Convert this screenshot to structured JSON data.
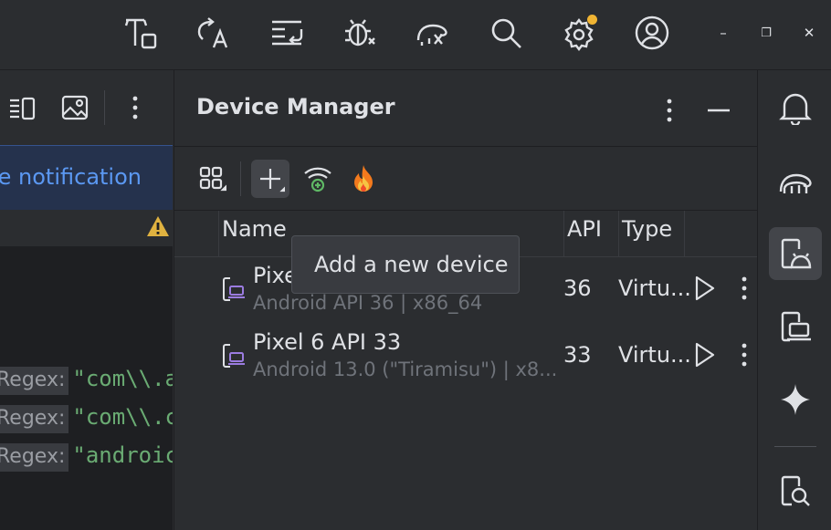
{
  "toolbar": {
    "icons": [
      "project-structure-icon",
      "translate-icon",
      "format-icon",
      "debug-bug-icon",
      "gradle-sync-icon",
      "search-icon",
      "settings-icon",
      "account-icon"
    ],
    "settings_badge_color": "#f0b433"
  },
  "window_controls": {
    "minimize": "–",
    "restore": "❐",
    "close": "✕"
  },
  "editor": {
    "banner_text": "le notification",
    "code_lines": [
      {
        "key": "Regex:",
        "value": "\"com\\\\.a"
      },
      {
        "key": "Regex:",
        "value": "\"com\\\\.c"
      },
      {
        "key": "Regex:",
        "value": "\"androic"
      }
    ]
  },
  "device_manager": {
    "title": "Device Manager",
    "columns": {
      "name": "Name",
      "api": "API",
      "type": "Type"
    },
    "devices": [
      {
        "name": "Pixe",
        "subtitle": "Android API 36 | x86_64",
        "api": "36",
        "type": "Virtu..."
      },
      {
        "name": "Pixel 6 API 33",
        "subtitle": "Android 13.0 (\"Tiramisu\") | x8...",
        "api": "33",
        "type": "Virtu..."
      }
    ],
    "tooltip": "Add a new device"
  },
  "colors": {
    "accent_blue": "#5b98f2",
    "warning": "#e0b240",
    "device_icon": "#9b7ce0",
    "string_green": "#6aab73",
    "firebase_orange": "#f37a1d",
    "wifi_green": "#5fb865"
  }
}
